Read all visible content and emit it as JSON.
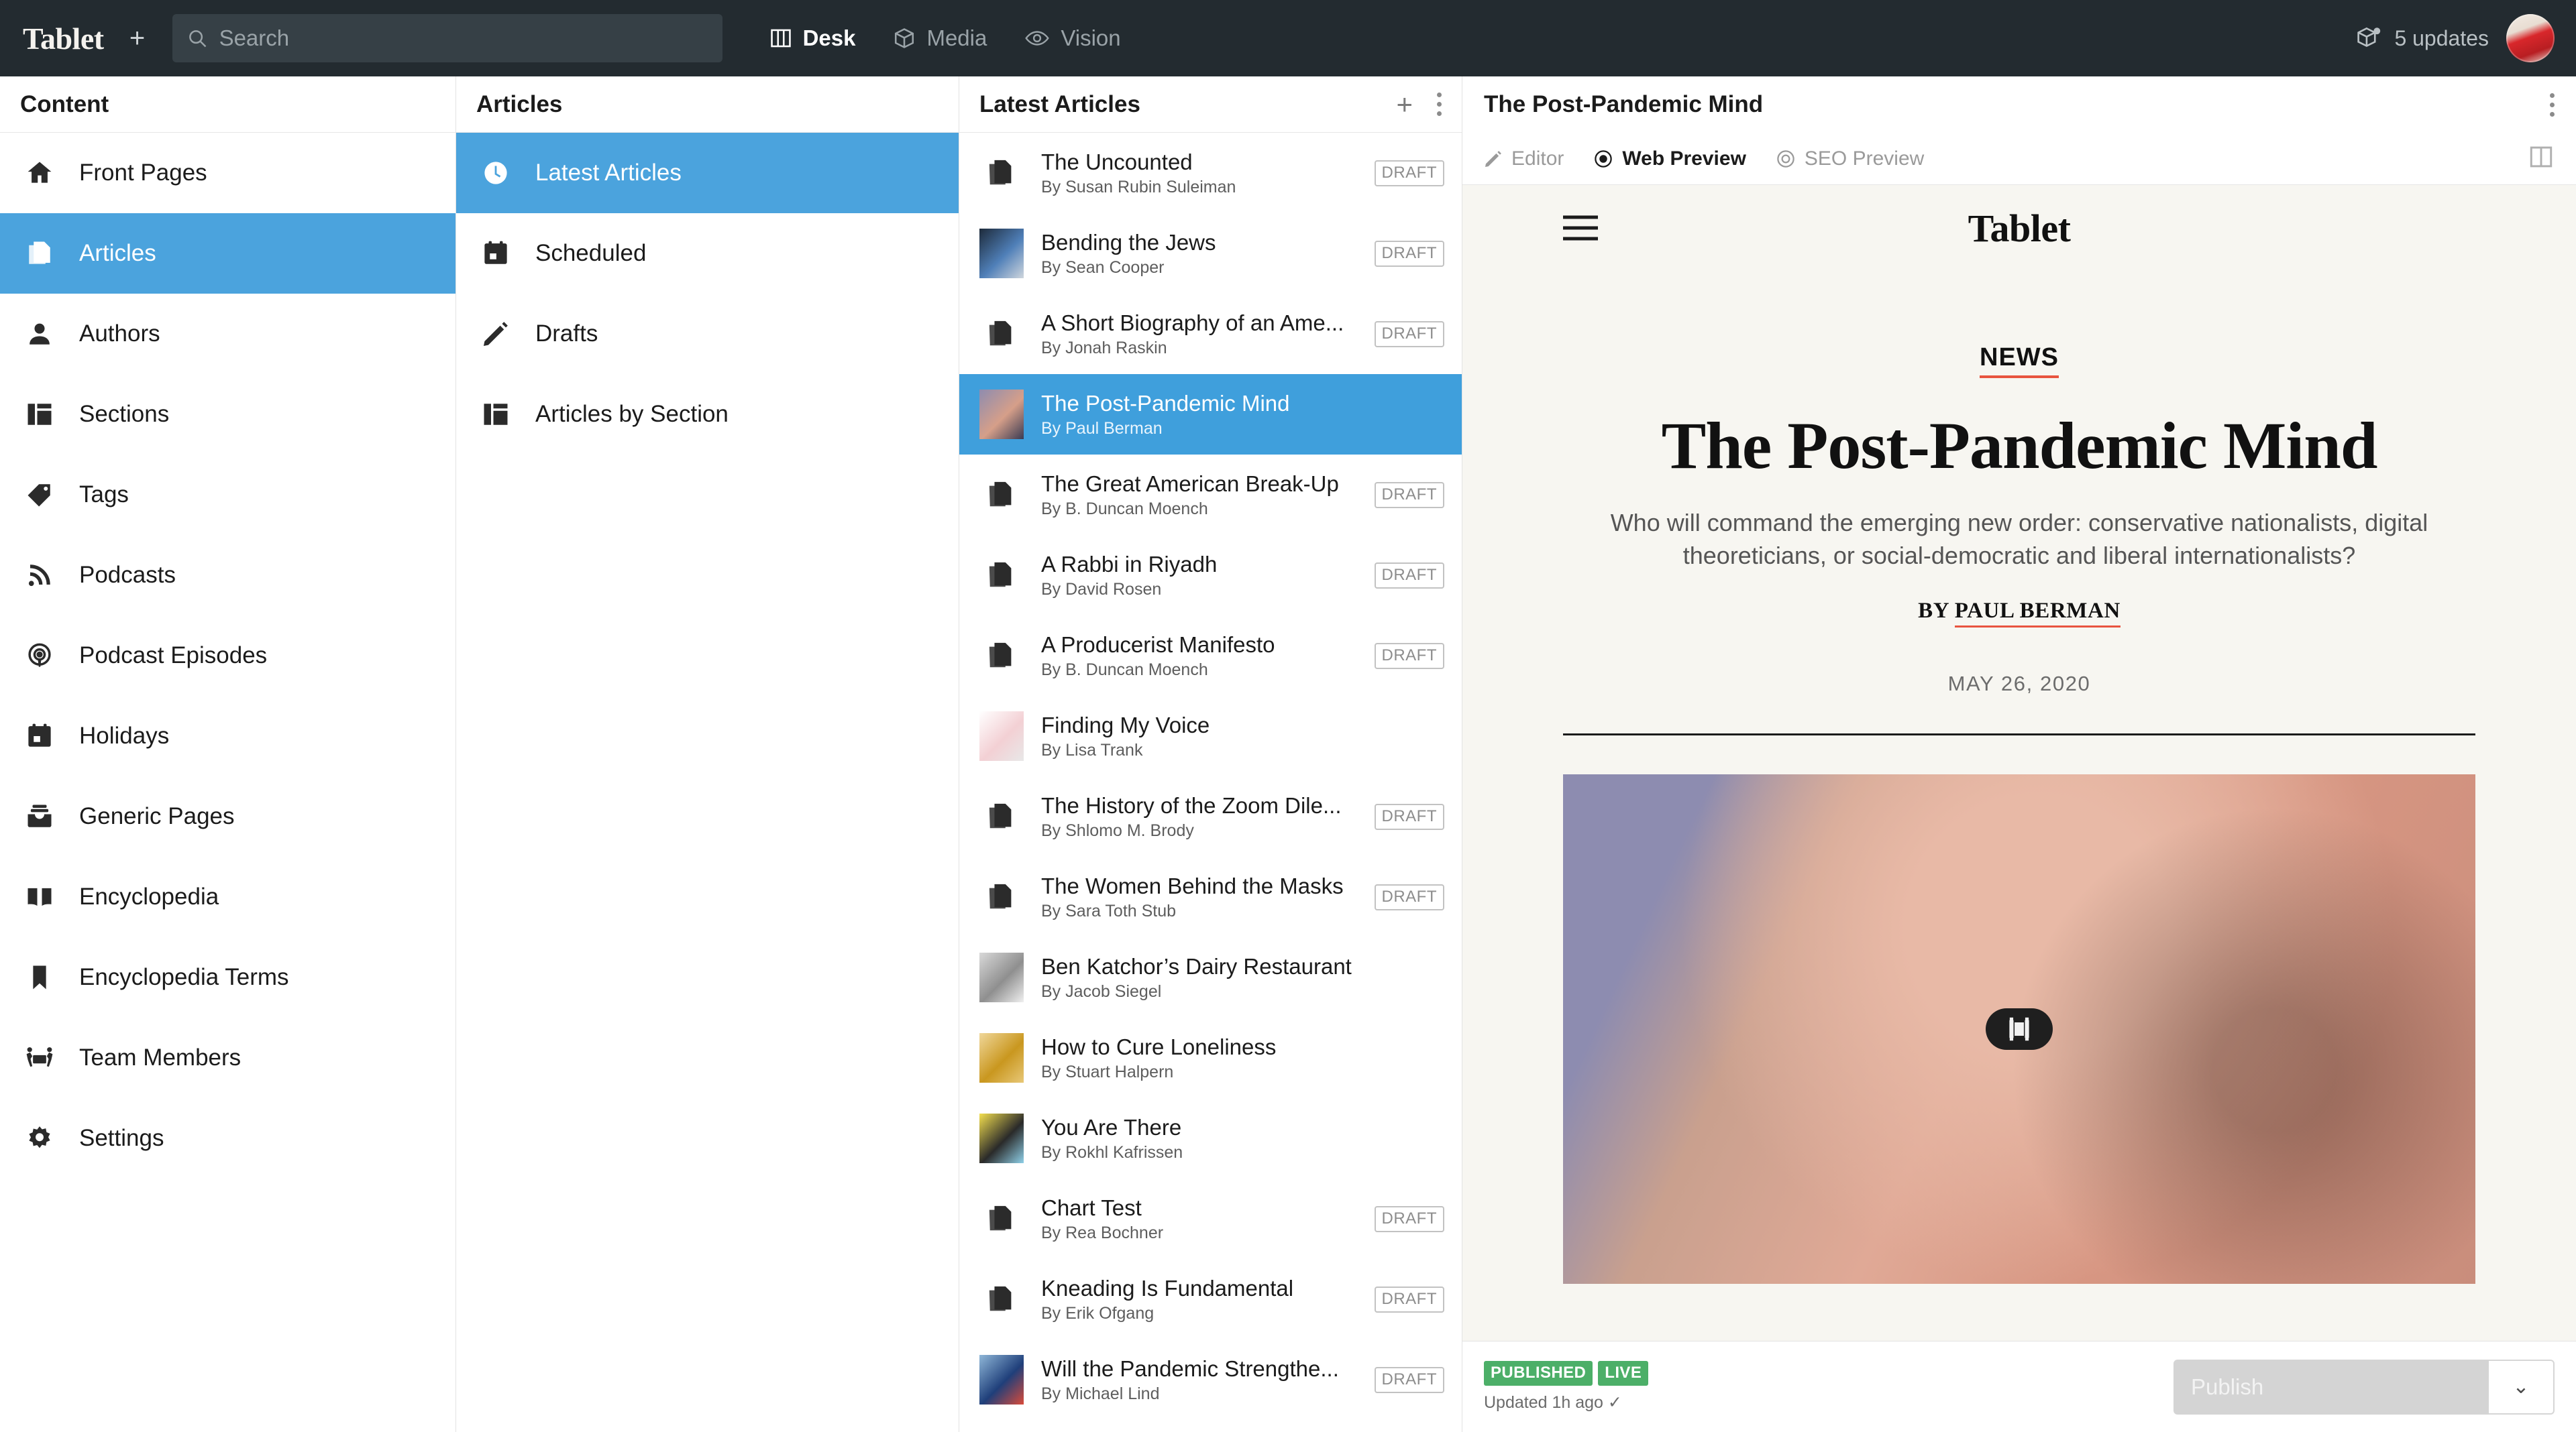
{
  "topbar": {
    "brand": "Tablet",
    "add_label": "+",
    "search_placeholder": "Search",
    "nav": [
      {
        "label": "Desk",
        "icon": "columns-icon",
        "active": true
      },
      {
        "label": "Media",
        "icon": "cube-icon",
        "active": false
      },
      {
        "label": "Vision",
        "icon": "eye-icon",
        "active": false
      }
    ],
    "updates_label": "5 updates"
  },
  "sidebar": {
    "title": "Content",
    "items": [
      {
        "label": "Front Pages",
        "icon": "home-icon"
      },
      {
        "label": "Articles",
        "icon": "documents-icon",
        "active": true
      },
      {
        "label": "Authors",
        "icon": "person-icon"
      },
      {
        "label": "Sections",
        "icon": "columns-layout-icon"
      },
      {
        "label": "Tags",
        "icon": "tag-icon"
      },
      {
        "label": "Podcasts",
        "icon": "rss-icon"
      },
      {
        "label": "Podcast Episodes",
        "icon": "podcast-icon"
      },
      {
        "label": "Holidays",
        "icon": "calendar-icon"
      },
      {
        "label": "Generic Pages",
        "icon": "inbox-icon"
      },
      {
        "label": "Encyclopedia",
        "icon": "book-icon"
      },
      {
        "label": "Encyclopedia Terms",
        "icon": "bookmark-icon"
      },
      {
        "label": "Team Members",
        "icon": "team-icon"
      },
      {
        "label": "Settings",
        "icon": "gear-icon"
      }
    ]
  },
  "articles_panel": {
    "title": "Articles",
    "items": [
      {
        "label": "Latest Articles",
        "icon": "clock-icon",
        "active": true
      },
      {
        "label": "Scheduled",
        "icon": "calendar-icon"
      },
      {
        "label": "Drafts",
        "icon": "pencil-icon"
      },
      {
        "label": "Articles by Section",
        "icon": "columns-layout-icon"
      }
    ]
  },
  "list_panel": {
    "title": "Latest Articles",
    "add_label": "+",
    "items": [
      {
        "title": "The Uncounted",
        "by": "By Susan Rubin Suleiman",
        "status": "DRAFT",
        "thumb": "doc-icon"
      },
      {
        "title": "Bending the Jews",
        "by": "By Sean Cooper",
        "status": "DRAFT",
        "thumb": "photo",
        "c1": "#1d2a3a",
        "c2": "#4f7fb8",
        "c3": "#cfd6dd"
      },
      {
        "title": "A Short Biography of an Ame...",
        "by": "By Jonah Raskin",
        "status": "DRAFT",
        "thumb": "doc-icon"
      },
      {
        "title": "The Post-Pandemic Mind",
        "by": "By Paul Berman",
        "status": "",
        "thumb": "photo",
        "selected": true,
        "c1": "#8d8cb0",
        "c2": "#d69f89",
        "c3": "#3a3a52"
      },
      {
        "title": "The Great American Break-Up",
        "by": "By B. Duncan Moench",
        "status": "DRAFT",
        "thumb": "doc-icon"
      },
      {
        "title": "A Rabbi in Riyadh",
        "by": "By David Rosen",
        "status": "DRAFT",
        "thumb": "doc-icon"
      },
      {
        "title": "A Producerist Manifesto",
        "by": "By B. Duncan Moench",
        "status": "DRAFT",
        "thumb": "doc-icon"
      },
      {
        "title": "Finding My Voice",
        "by": "By Lisa Trank",
        "status": "",
        "thumb": "photo",
        "c1": "#ffffff",
        "c2": "#f3d0d4",
        "c3": "#e8e8e8"
      },
      {
        "title": "The History of the Zoom Dile...",
        "by": "By Shlomo M. Brody",
        "status": "DRAFT",
        "thumb": "doc-icon"
      },
      {
        "title": "The Women Behind the Masks",
        "by": "By Sara Toth Stub",
        "status": "DRAFT",
        "thumb": "doc-icon"
      },
      {
        "title": "Ben Katchor’s Dairy Restaurant",
        "by": "By Jacob Siegel",
        "status": "",
        "thumb": "photo",
        "c1": "#d9d9d9",
        "c2": "#8f8f8f",
        "c3": "#f0f0f0"
      },
      {
        "title": "How to Cure Loneliness",
        "by": "By Stuart Halpern",
        "status": "",
        "thumb": "photo",
        "c1": "#f0d79a",
        "c2": "#c9971f",
        "c3": "#e8c878"
      },
      {
        "title": "You Are There",
        "by": "By Rokhl Kafrissen",
        "status": "",
        "thumb": "photo",
        "c1": "#f3df4e",
        "c2": "#2a2a2a",
        "c3": "#8fd0e8"
      },
      {
        "title": "Chart Test",
        "by": "By Rea Bochner",
        "status": "DRAFT",
        "thumb": "doc-icon"
      },
      {
        "title": "Kneading Is Fundamental",
        "by": "By Erik Ofgang",
        "status": "DRAFT",
        "thumb": "doc-icon"
      },
      {
        "title": "Will the Pandemic Strengthe...",
        "by": "By Michael Lind",
        "status": "DRAFT",
        "thumb": "photo",
        "c1": "#8fb7d8",
        "c2": "#1f3f7a",
        "c3": "#d94b3a"
      }
    ]
  },
  "preview": {
    "title": "The Post-Pandemic Mind",
    "tabs": [
      {
        "label": "Editor",
        "icon": "pencil-icon",
        "active": false
      },
      {
        "label": "Web Preview",
        "icon": "eye-filled-icon",
        "active": true
      },
      {
        "label": "SEO Preview",
        "icon": "eye-outline-icon",
        "active": false
      }
    ],
    "site": {
      "logo": "Tablet",
      "kicker": "NEWS",
      "headline": "The Post-Pandemic Mind",
      "deck": "Who will command the emerging new order: conservative nationalists, digital theoreticians, or social-democratic and liberal internationalists?",
      "byline_prefix": "BY ",
      "byline_name": "PAUL BERMAN",
      "date": "MAY 26, 2020"
    },
    "footer": {
      "badge_published": "PUBLISHED",
      "badge_live": "LIVE",
      "updated": "Updated 1h ago ✓",
      "publish_label": "Publish",
      "caret": "⌄"
    }
  },
  "colors": {
    "accent_blue": "#4ba3dd",
    "topbar_dark": "#232b30",
    "status_green": "#4caf68",
    "rule_red": "#e8543f",
    "preview_bg": "#f7f6f1"
  }
}
